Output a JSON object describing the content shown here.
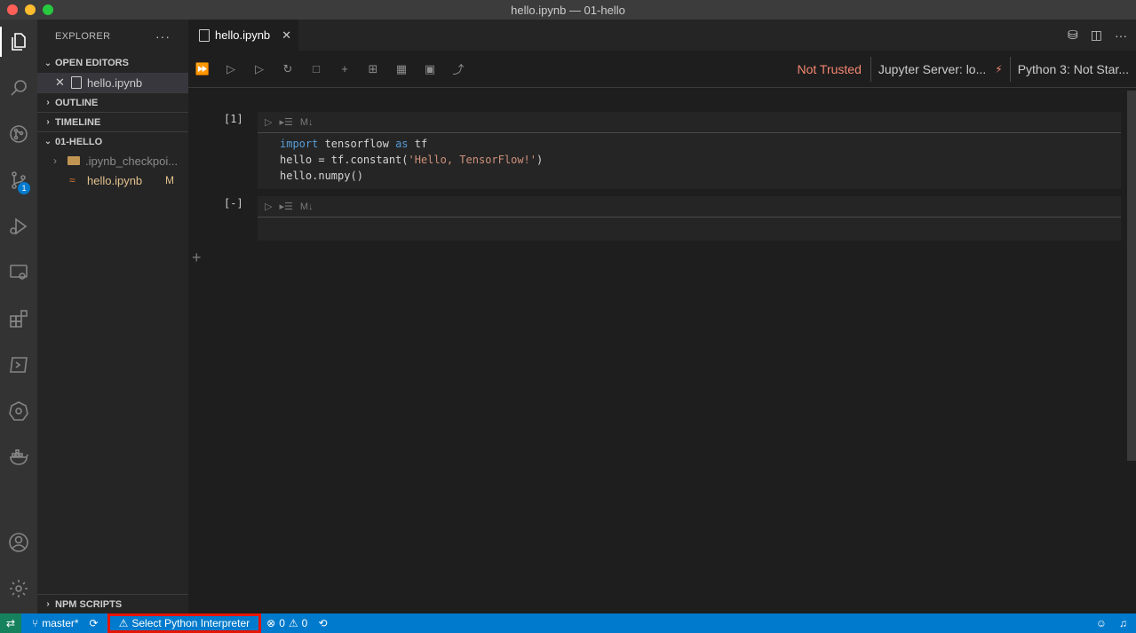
{
  "window": {
    "title": "hello.ipynb — 01-hello"
  },
  "activity_bar": {
    "items": [
      "explorer-icon",
      "search-icon",
      "source-control-icon",
      "scm-icon",
      "run-debug-icon",
      "remote-explorer-icon",
      "extensions-icon",
      "terminal-icon",
      "kubernetes-icon",
      "docker-icon",
      "account-icon",
      "settings-icon"
    ],
    "scm_badge": "1"
  },
  "sidebar": {
    "header": "EXPLORER",
    "more": "···",
    "open_editors": {
      "label": "OPEN EDITORS",
      "items": [
        {
          "name": "hello.ipynb"
        }
      ]
    },
    "outline": "OUTLINE",
    "timeline": "TIMELINE",
    "folder": {
      "label": "01-HELLO",
      "items": [
        {
          "name": ".ipynb_checkpoi...",
          "type": "folder"
        },
        {
          "name": "hello.ipynb",
          "status": "M"
        }
      ]
    },
    "npm_scripts": "NPM SCRIPTS"
  },
  "editor": {
    "tab": {
      "label": "hello.ipynb"
    },
    "trust": "Not Trusted",
    "jupyter_server": "Jupyter Server: lo...",
    "kernel": "Python 3: Not Star...",
    "cells": [
      {
        "count": "[1]",
        "cell_type_label": "M↓",
        "lines": {
          "l1_kw1": "import",
          "l1_mid": " tensorflow ",
          "l1_kw2": "as",
          "l1_end": " tf",
          "l2_start": "hello = tf.constant(",
          "l2_str": "'Hello, TensorFlow!'",
          "l2_end": ")",
          "l3": "hello.numpy()"
        }
      },
      {
        "count": "[-]",
        "cell_type_label": "M↓"
      }
    ]
  },
  "status_bar": {
    "branch": "master*",
    "interpreter": "Select Python Interpreter",
    "errors": "0",
    "warnings": "0"
  },
  "colors": {
    "status_bar": "#007acc",
    "not_trusted": "#f48771",
    "highlight_box": "#e51400"
  }
}
